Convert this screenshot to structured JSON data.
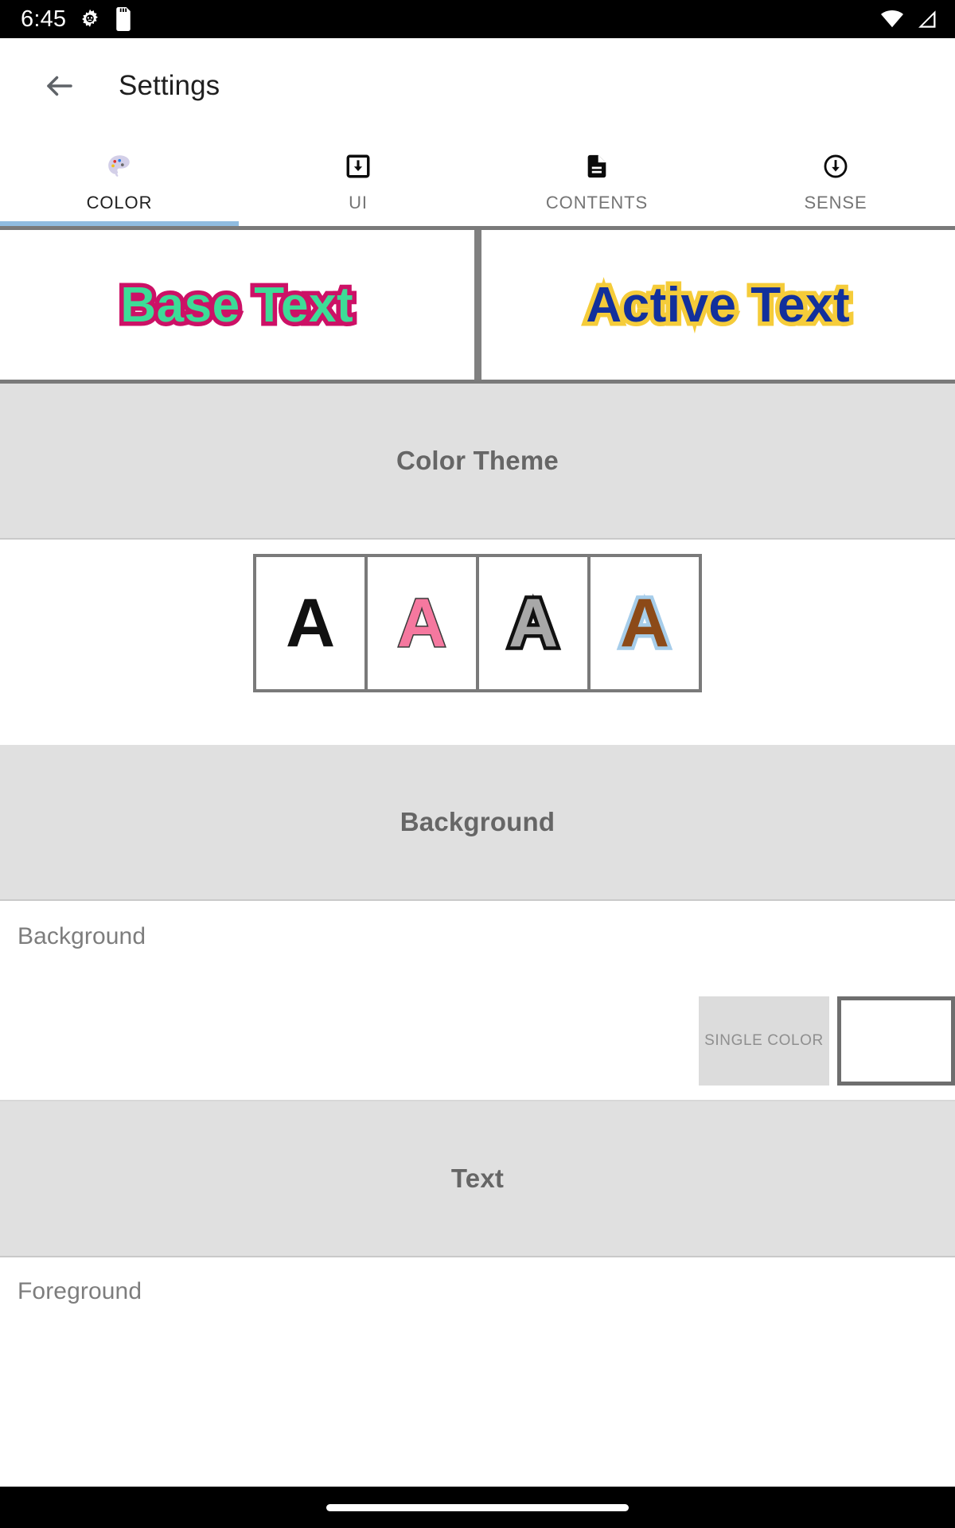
{
  "status_bar": {
    "clock": "6:45",
    "left_icons": [
      "android-settings-icon",
      "sd-card-icon"
    ],
    "right_icons": [
      "wifi-icon",
      "cellular-signal-icon"
    ],
    "background_color": "#000000",
    "foreground_color": "#ffffff"
  },
  "app_bar": {
    "back_icon": "back-arrow-icon",
    "title": "Settings"
  },
  "tabs": {
    "active_index": 0,
    "indicator_color": "#90bce0",
    "items": [
      {
        "label": "COLOR",
        "icon": "palette-icon",
        "glyph": "🎨",
        "active": true
      },
      {
        "label": "UI",
        "icon": "download-box-icon",
        "glyph": "",
        "active": false
      },
      {
        "label": "CONTENTS",
        "icon": "document-icon",
        "glyph": "",
        "active": false
      },
      {
        "label": "SENSE",
        "icon": "download-circle-icon",
        "glyph": "",
        "active": false
      }
    ]
  },
  "preview": {
    "base": {
      "text": "Base Text",
      "fill_color": "#3ddc97",
      "outline_color": "#cc1166"
    },
    "active": {
      "text": "Active Text",
      "fill_color": "#12309c",
      "outline_color": "#f5cc3a"
    }
  },
  "sections": {
    "color_theme": {
      "title": "Color Theme",
      "swatches": [
        {
          "letter": "A",
          "fill_color": "#111111",
          "outline_color": "#111111"
        },
        {
          "letter": "A",
          "fill_color": "#f5789f",
          "outline_color": "#3a3a3a"
        },
        {
          "letter": "A",
          "fill_color": "#a8a8a8",
          "outline_color": "#111111"
        },
        {
          "letter": "A",
          "fill_color": "#8c4a18",
          "outline_color": "#a6cdea"
        }
      ]
    },
    "background": {
      "title": "Background",
      "row_label": "Background",
      "mode_button": "SINGLE COLOR",
      "color_chip_value": "#ffffff"
    },
    "text": {
      "title": "Text",
      "row_label": "Foreground"
    }
  },
  "nav_bar": {
    "handle": "home-gesture-pill"
  }
}
